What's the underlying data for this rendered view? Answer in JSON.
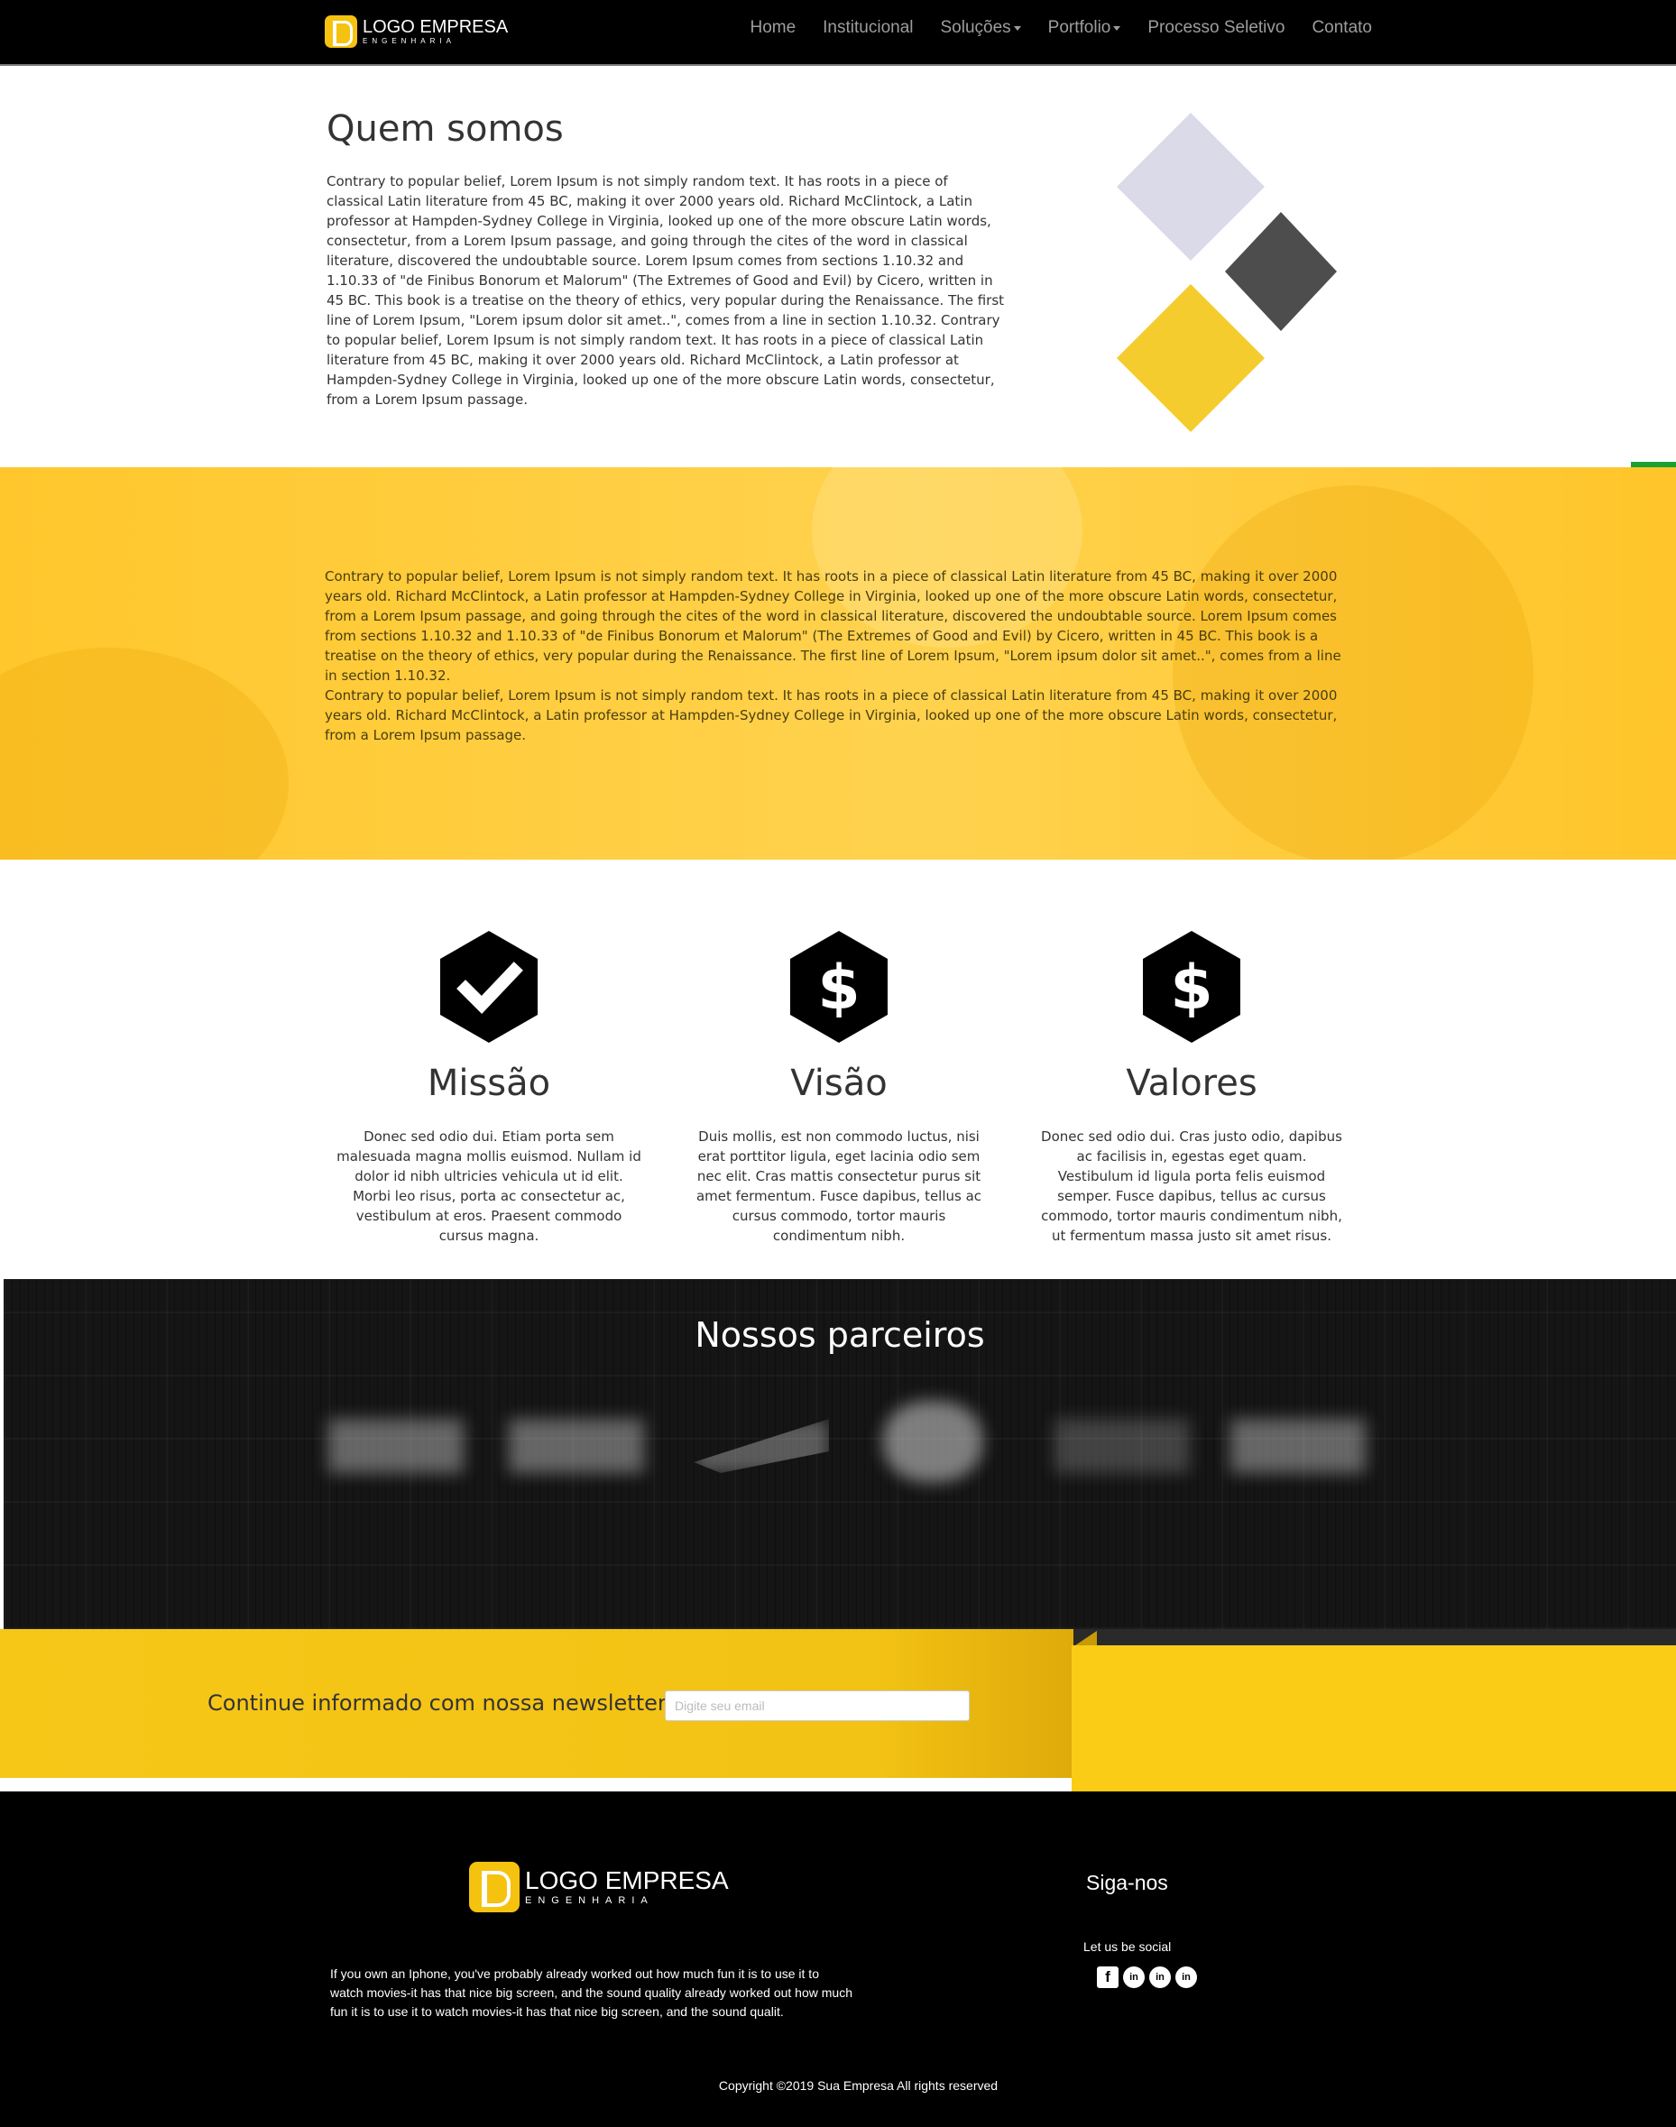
{
  "brand": {
    "name": "LOGO EMPRESA",
    "tagline": "ENGENHARIA",
    "accent": "#f5c20f"
  },
  "nav": {
    "items": [
      {
        "label": "Home",
        "dropdown": false
      },
      {
        "label": "Institucional",
        "dropdown": false
      },
      {
        "label": "Soluções",
        "dropdown": true
      },
      {
        "label": "Portfolio",
        "dropdown": true
      },
      {
        "label": "Processo Seletivo",
        "dropdown": false
      },
      {
        "label": "Contato",
        "dropdown": false
      }
    ]
  },
  "side_contacts": [
    {
      "icon": "whatsapp-icon",
      "color": "#1aa131"
    },
    {
      "icon": "envelope-icon",
      "color": "#0f72b6"
    }
  ],
  "about": {
    "title": "Quem somos",
    "text": "Contrary to popular belief, Lorem Ipsum is not simply random text. It has roots in a piece of classical Latin literature from 45 BC, making it over 2000 years old. Richard McClintock, a Latin professor at Hampden-Sydney College in Virginia, looked up one of the more obscure Latin words, consectetur, from a Lorem Ipsum passage, and going through the cites of the word in classical literature, discovered the undoubtable source. Lorem Ipsum comes from sections 1.10.32 and 1.10.33 of \"de Finibus Bonorum et Malorum\" (The Extremes of Good and Evil) by Cicero, written in 45 BC. This book is a treatise on the theory of ethics, very popular during the Renaissance. The first line of Lorem Ipsum, \"Lorem ipsum dolor sit amet..\", comes from a line in section 1.10.32. Contrary to popular belief, Lorem Ipsum is not simply random text. It has roots in a piece of classical Latin literature from 45 BC, making it over 2000 years old. Richard McClintock, a Latin professor at Hampden-Sydney College in Virginia, looked up one of the more obscure Latin words, consectetur, from a Lorem Ipsum passage.",
    "diamond_colors": [
      "#dadae8",
      "#4d4d4d",
      "#f5cc2e"
    ]
  },
  "band": {
    "title": "",
    "paragraph_1": "Contrary to popular belief, Lorem Ipsum is not simply random text. It has roots in a piece of classical Latin literature from 45 BC, making it over 2000 years old. Richard McClintock, a Latin professor at Hampden-Sydney College in Virginia, looked up one of the more obscure Latin words, consectetur, from a Lorem Ipsum passage, and going through the cites of the word in classical literature, discovered the undoubtable source. Lorem Ipsum comes from sections 1.10.32 and 1.10.33 of \"de Finibus Bonorum et Malorum\" (The Extremes of Good and Evil) by Cicero, written in 45 BC. This book is a treatise on the theory of ethics, very popular during the Renaissance. The first line of Lorem Ipsum, \"Lorem ipsum dolor sit amet..\", comes from a line in section 1.10.32.",
    "paragraph_2": "Contrary to popular belief, Lorem Ipsum is not simply random text. It has roots in a piece of classical Latin literature from 45 BC, making it over 2000 years old. Richard McClintock, a Latin professor at Hampden-Sydney College in Virginia, looked up one of the more obscure Latin words, consectetur, from a Lorem Ipsum passage."
  },
  "features": [
    {
      "icon": "checkmark-hexagon-icon",
      "title": "Missão",
      "text": "Donec sed odio dui. Etiam porta sem malesuada magna mollis euismod. Nullam id dolor id nibh ultricies vehicula ut id elit. Morbi leo risus, porta ac consectetur ac, vestibulum at eros. Praesent commodo cursus magna."
    },
    {
      "icon": "dollar-hexagon-icon",
      "title": "Visão",
      "text": "Duis mollis, est non commodo luctus, nisi erat porttitor ligula, eget lacinia odio sem nec elit. Cras mattis consectetur purus sit amet fermentum. Fusce dapibus, tellus ac cursus commodo, tortor mauris condimentum nibh."
    },
    {
      "icon": "dollar-hexagon-icon",
      "title": "Valores",
      "text": "Donec sed odio dui. Cras justo odio, dapibus ac facilisis in, egestas eget quam. Vestibulum id ligula porta felis euismod semper. Fusce dapibus, tellus ac cursus commodo, tortor mauris condimentum nibh, ut fermentum massa justo sit amet risus."
    }
  ],
  "partners": {
    "title": "Nossos parceiros",
    "logo_count": 6
  },
  "newsletter": {
    "label": "Continue informado com nossa newsletter",
    "placeholder": "Digite seu email",
    "value": ""
  },
  "footer": {
    "text": "If you own an Iphone, you've probably already worked out how much fun it is to use it to watch movies-it has that nice big screen, and the sound quality already worked out how much fun it is to use it to watch movies-it has that nice big screen, and the sound qualit.",
    "follow_title": "Siga-nos",
    "social_caption": "Let us be social",
    "social": [
      {
        "icon": "facebook-icon",
        "glyph": "f"
      },
      {
        "icon": "linkedin-icon",
        "glyph": "in"
      },
      {
        "icon": "linkedin-icon",
        "glyph": "in"
      },
      {
        "icon": "linkedin-icon",
        "glyph": "in"
      }
    ],
    "copyright": "Copyright ©2019 Sua Empresa All rights reserved"
  }
}
